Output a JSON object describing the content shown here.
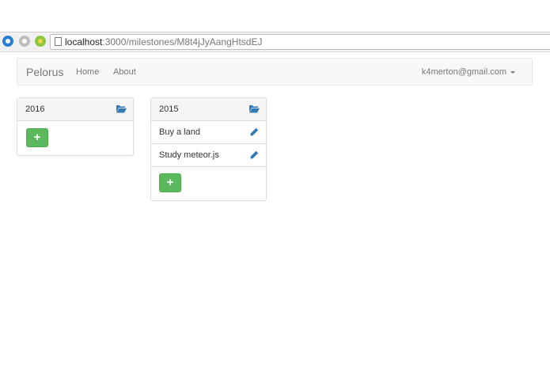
{
  "browser": {
    "url_host": "localhost",
    "url_rest": ":3000/milestones/M8t4jJyAangHtsdEJ"
  },
  "navbar": {
    "brand": "Pelorus",
    "links": [
      "Home",
      "About"
    ],
    "user": "k4merton@gmail.com"
  },
  "milestones": [
    {
      "title": "2016",
      "items": [],
      "add_label": "+"
    },
    {
      "title": "2015",
      "items": [
        "Buy a land",
        "Study meteor.js"
      ],
      "add_label": "+"
    }
  ],
  "colors": {
    "accent_blue": "#337ab7",
    "add_green": "#5cb85c"
  },
  "icons": {
    "folder": "folder-open-icon",
    "edit": "pencil-icon",
    "add": "plus-icon"
  }
}
